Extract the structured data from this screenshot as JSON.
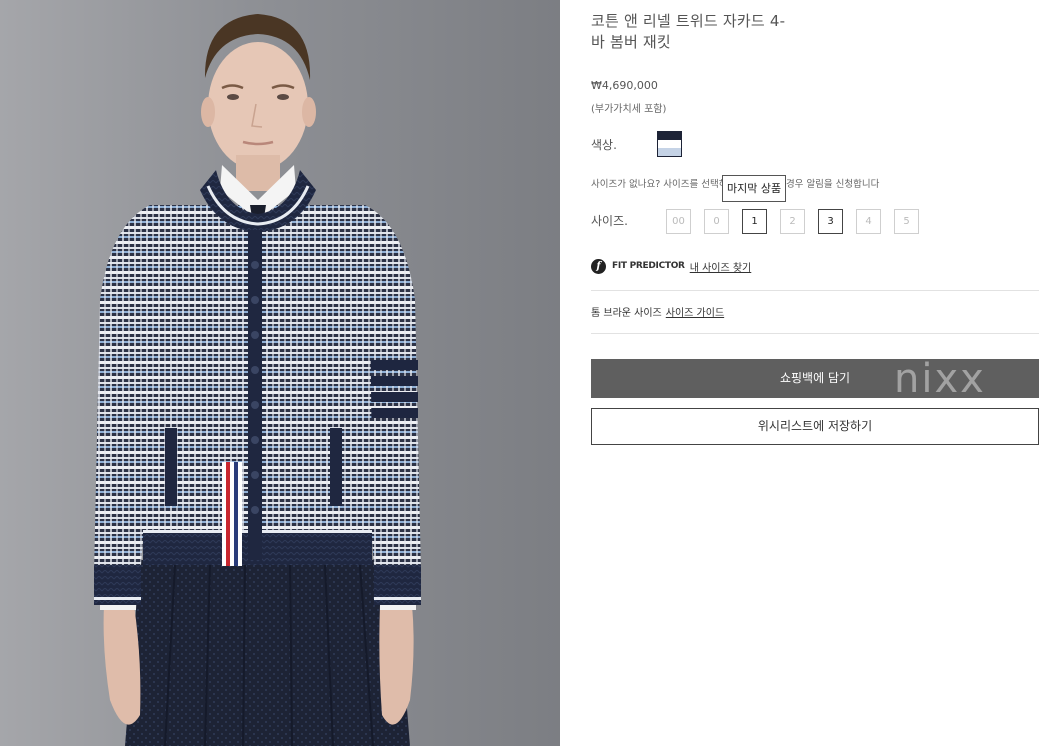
{
  "product": {
    "title_line1": "코튼 앤 리넬 트위드 자카드 4-",
    "title_line2": "바 봄버 재킷",
    "price": "₩4,690,000",
    "tax_note": "(부가가치세 포함)",
    "image_alt": "product model photo"
  },
  "color": {
    "label": "색상.",
    "swatch_colors": [
      "#1d2336",
      "#ffffff",
      "#c5d3e6"
    ]
  },
  "size_notice": {
    "text": "사이즈가 없나요? 사이즈를 선택하시면 재입고될 경우 알림을 신청합니다",
    "tooltip": "마지막 상품"
  },
  "sizes": {
    "label": "사이즈.",
    "options": [
      {
        "label": "00",
        "available": false
      },
      {
        "label": "0",
        "available": false
      },
      {
        "label": "1",
        "available": true
      },
      {
        "label": "2",
        "available": false
      },
      {
        "label": "3",
        "available": true
      },
      {
        "label": "4",
        "available": false
      },
      {
        "label": "5",
        "available": false
      }
    ]
  },
  "fit_predictor": {
    "logo": "f",
    "brand": "FIT PREDICTOR",
    "link": "내 사이즈 찾기"
  },
  "size_guide": {
    "prefix": "톰 브라운 사이즈",
    "link": "사이즈 가이드"
  },
  "actions": {
    "add_to_bag": "쇼핑백에 담기",
    "wishlist": "위시리스트에 저장하기"
  },
  "watermark": "nixx"
}
